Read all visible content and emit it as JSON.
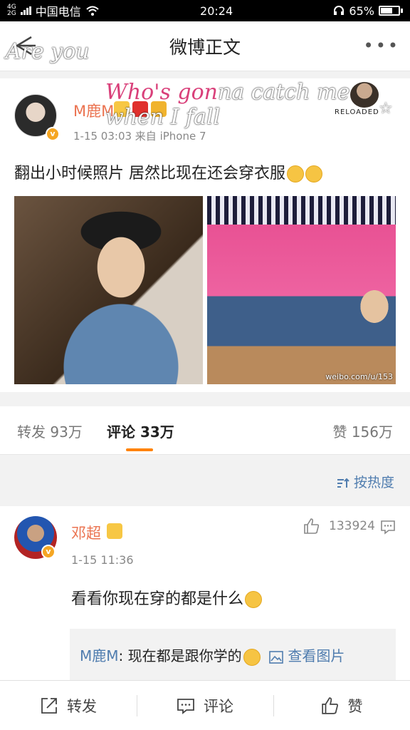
{
  "status_bar": {
    "network_top": "4G",
    "network_bottom": "2G",
    "carrier": "中国电信",
    "time": "20:24",
    "battery": "65%"
  },
  "nav": {
    "title": "微博正文",
    "more": "•••"
  },
  "overlay": {
    "line1": "Are you",
    "line2_a": "Who's gon",
    "line2_b": "na catch me when I fall",
    "reloaded": "RELOADED"
  },
  "post": {
    "author": "M鹿M",
    "meta": "1-15 03:03   来自 iPhone 7",
    "text": "翻出小时候照片  居然比现在还会穿衣服",
    "watermark": "weibo.com/u/153"
  },
  "tabs": {
    "repost": "转发 93万",
    "comment": "评论 33万",
    "like": "赞 156万"
  },
  "sort": {
    "label": "按热度"
  },
  "comment": {
    "author": "邓超",
    "time": "1-15 11:36",
    "likes": "133924",
    "text": "看看你现在穿的都是什么",
    "reply_author": "M鹿M",
    "reply_text": ": 现在都是跟你学的",
    "reply_link": "查看图片"
  },
  "bottom_bar": {
    "repost": "转发",
    "comment": "评论",
    "like": "赞"
  },
  "colors": {
    "accent_orange": "#ff8200",
    "name_orange": "#eb7350",
    "link_blue": "#507daf"
  }
}
